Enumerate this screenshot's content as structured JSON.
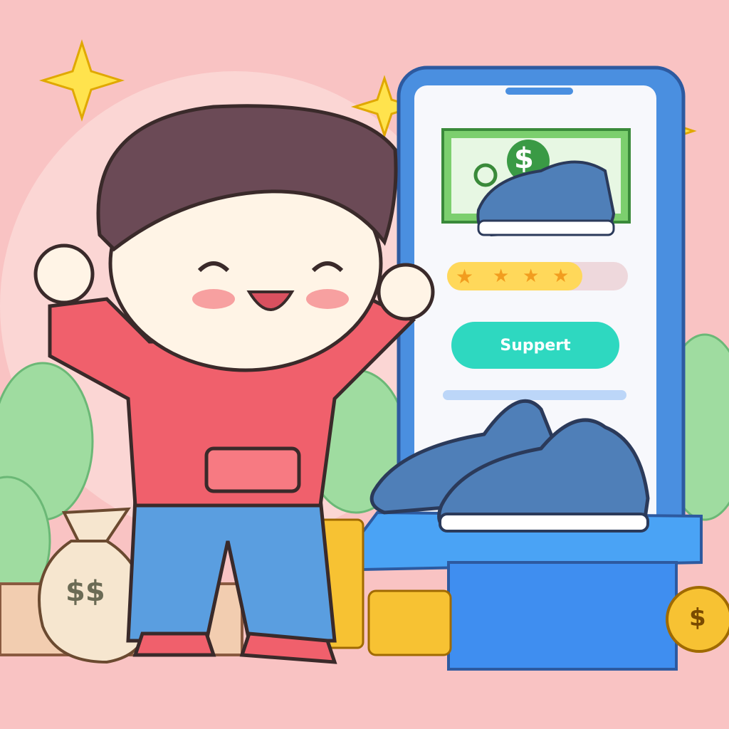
{
  "scene": {
    "phone_screen": {
      "button_label": "Suppert",
      "rating_stars": 4,
      "rating_max": 5,
      "bill_symbol": "$"
    },
    "money_bag_label": "$$",
    "coin_symbol": "$"
  },
  "colors": {
    "background": "#f9c3c3",
    "phone_frame": "#4a8fe0",
    "button": "#2ed8c0",
    "hoodie": "#f0606c",
    "jeans": "#5a9ee0",
    "shoe_box": "#3f8ef0",
    "coins": "#f7c233"
  }
}
